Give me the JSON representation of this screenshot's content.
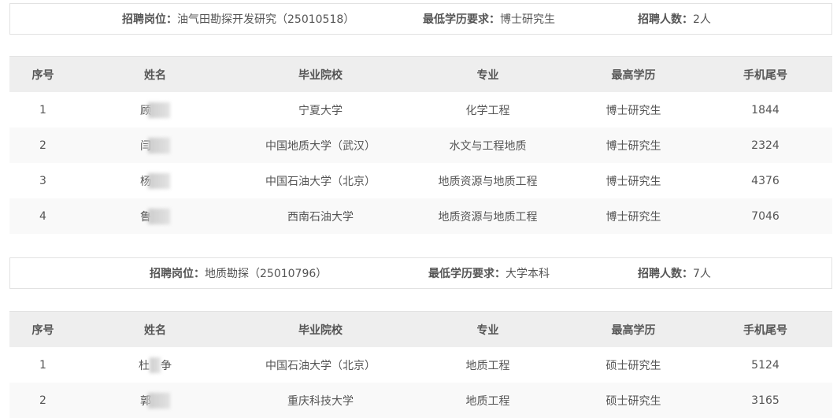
{
  "sections": [
    {
      "position_label": "招聘岗位：",
      "position_value": "油气田勘探开发研究（25010518）",
      "edu_label": "最低学历要求：",
      "edu_value": "博士研究生",
      "count_label": "招聘人数：",
      "count_value": "2人",
      "headers": [
        "序号",
        "姓名",
        "毕业院校",
        "专业",
        "最高学历",
        "手机尾号"
      ],
      "rows": [
        {
          "no": "1",
          "name": "顾",
          "school": "宁夏大学",
          "major": "化学工程",
          "degree": "博士研究生",
          "phone": "1844"
        },
        {
          "no": "2",
          "name": "闫",
          "school": "中国地质大学（武汉）",
          "major": "水文与工程地质",
          "degree": "博士研究生",
          "phone": "2324"
        },
        {
          "no": "3",
          "name": "杨",
          "school": "中国石油大学（北京）",
          "major": "地质资源与地质工程",
          "degree": "博士研究生",
          "phone": "4376"
        },
        {
          "no": "4",
          "name": "鲁",
          "school": "西南石油大学",
          "major": "地质资源与地质工程",
          "degree": "博士研究生",
          "phone": "7046"
        }
      ]
    },
    {
      "position_label": "招聘岗位：",
      "position_value": "地质勘探（25010796）",
      "edu_label": "最低学历要求：",
      "edu_value": "大学本科",
      "count_label": "招聘人数：",
      "count_value": "7人",
      "headers": [
        "序号",
        "姓名",
        "毕业院校",
        "专业",
        "最高学历",
        "手机尾号"
      ],
      "rows": [
        {
          "no": "1",
          "name": "杜",
          "name2": "争",
          "school": "中国石油大学（北京）",
          "major": "地质工程",
          "degree": "硕士研究生",
          "phone": "5124"
        },
        {
          "no": "2",
          "name": "郭",
          "school": "重庆科技大学",
          "major": "地质工程",
          "degree": "硕士研究生",
          "phone": "3165"
        }
      ]
    }
  ]
}
